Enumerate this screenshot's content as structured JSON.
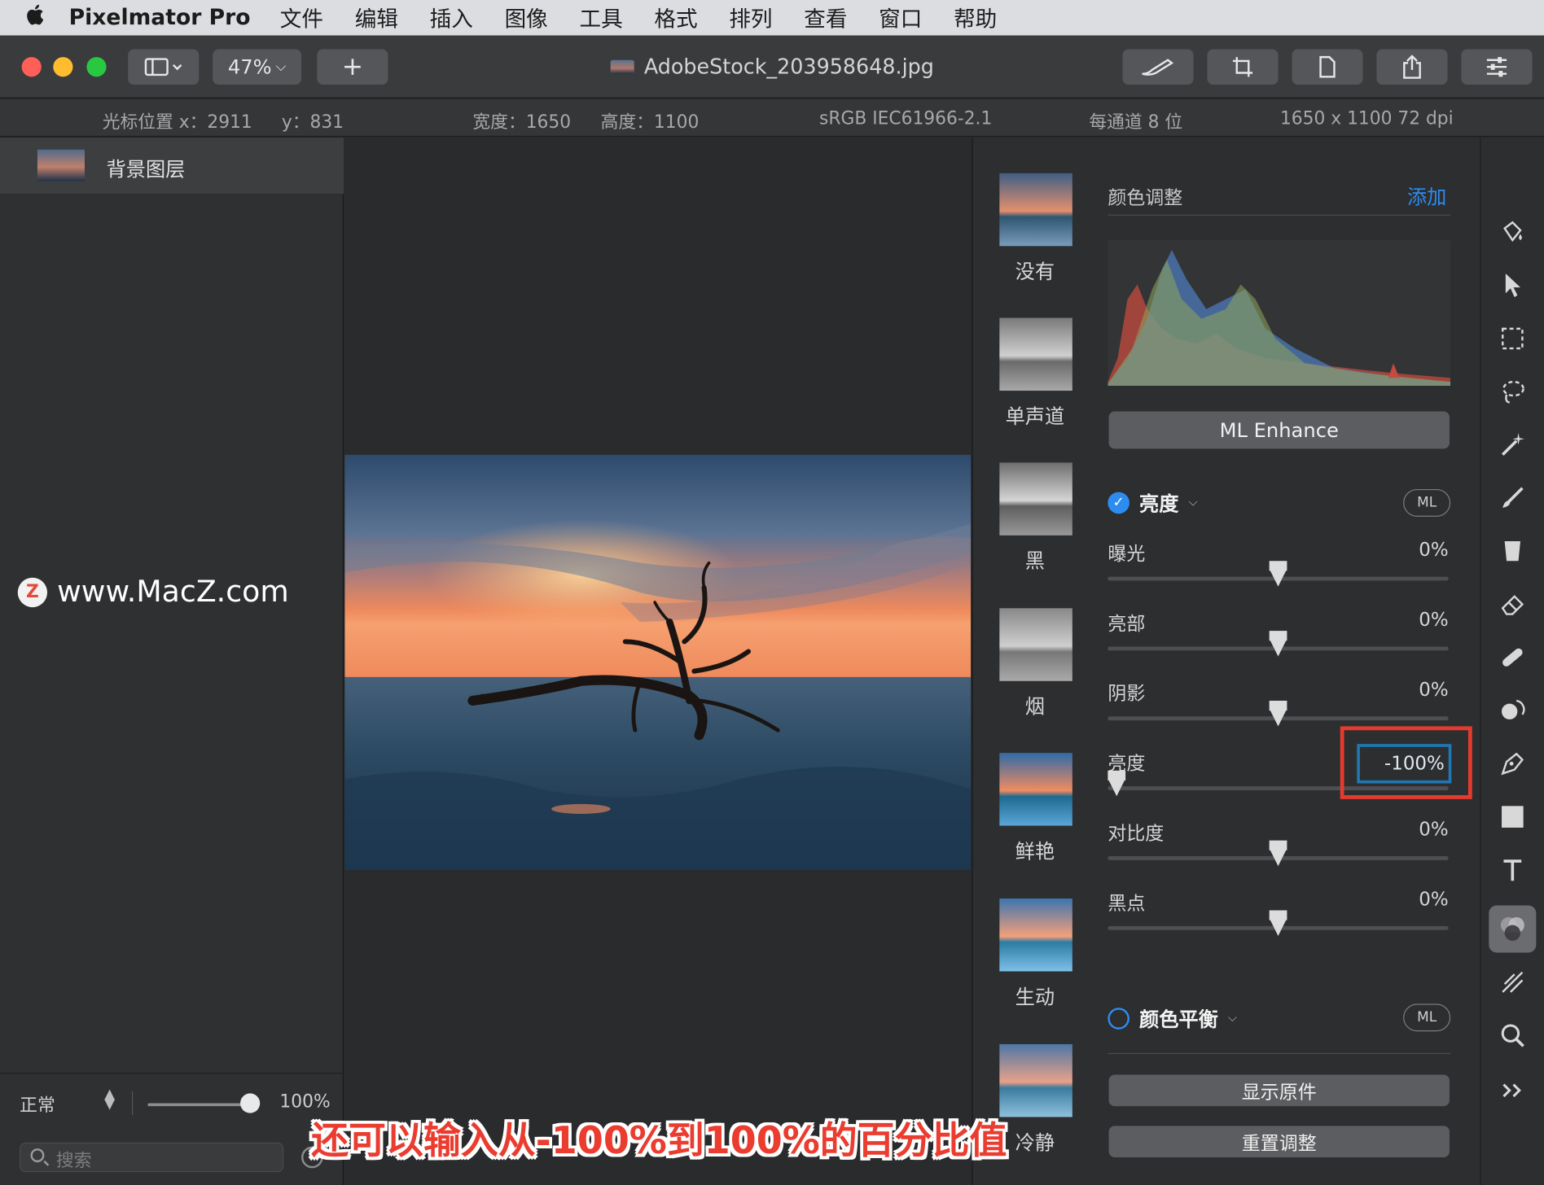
{
  "menubar": {
    "app_name": "Pixelmator Pro",
    "items": [
      "文件",
      "编辑",
      "插入",
      "图像",
      "工具",
      "格式",
      "排列",
      "查看",
      "窗口",
      "帮助"
    ]
  },
  "toolbar": {
    "zoom": "47%",
    "add": "+",
    "doc_title": "AdobeStock_203958648.jpg"
  },
  "infobar": {
    "cursor_x": "光标位置 x：2911",
    "cursor_y": "y：831",
    "width": "宽度：1650",
    "height": "高度：1100",
    "profile": "sRGB IEC61966-2.1",
    "depth": "每通道 8 位",
    "size": "1650 x 1100 72 dpi"
  },
  "layers": {
    "layer_name": "背景图层",
    "blend_mode": "正常",
    "opacity": "100%",
    "opacity_level": 1.0,
    "search_placeholder": "搜索"
  },
  "watermark": {
    "logo": "Z",
    "text": "www.MacZ.com"
  },
  "caption": "还可以输入从-100%到100%的百分比值",
  "presets": [
    {
      "label": "没有",
      "style": "color"
    },
    {
      "label": "单声道",
      "style": "mono"
    },
    {
      "label": "黑",
      "style": "mono"
    },
    {
      "label": "烟",
      "style": "mono"
    },
    {
      "label": "鲜艳",
      "style": "color"
    },
    {
      "label": "生动",
      "style": "color"
    },
    {
      "label": "冷静",
      "style": "color"
    }
  ],
  "adjustments": {
    "title": "颜色调整",
    "add": "添加",
    "ml_enhance": "ML Enhance",
    "section1": {
      "title": "亮度",
      "enabled": true,
      "ml": "ML",
      "sliders": [
        {
          "label": "曝光",
          "value": "0%",
          "level": 0
        },
        {
          "label": "亮部",
          "value": "0%",
          "level": 0
        },
        {
          "label": "阴影",
          "value": "0%",
          "level": 0
        },
        {
          "label": "亮度",
          "value": "-100%",
          "level": -100
        },
        {
          "label": "对比度",
          "value": "0%",
          "level": 0
        },
        {
          "label": "黑点",
          "value": "0%",
          "level": 0
        }
      ]
    },
    "section2": {
      "title": "颜色平衡",
      "enabled": false,
      "ml": "ML"
    },
    "show_original": "显示原件",
    "reset": "重置调整"
  },
  "tools": [
    "paint-bucket-icon",
    "pointer-icon",
    "rect-select-icon",
    "lasso-icon",
    "magic-wand-icon",
    "brush-icon",
    "fill-icon",
    "eraser-icon",
    "heal-icon",
    "clone-icon",
    "pen-icon",
    "shape-icon",
    "text-icon",
    "color-adjust-icon",
    "effects-icon",
    "zoom-icon",
    "more-tools-icon"
  ]
}
